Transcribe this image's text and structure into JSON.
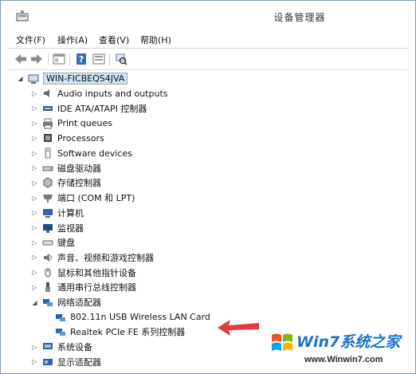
{
  "window": {
    "title": "设备管理器"
  },
  "menu": [
    "文件(F)",
    "操作(A)",
    "查看(V)",
    "帮助(H)"
  ],
  "tree": {
    "root": "WIN-FICBEQS4JVA",
    "categories": [
      {
        "label": "Audio inputs and outputs",
        "icon": "speaker-icon"
      },
      {
        "label": "IDE ATA/ATAPI 控制器",
        "icon": "ide-controller-icon"
      },
      {
        "label": "Print queues",
        "icon": "printer-icon"
      },
      {
        "label": "Processors",
        "icon": "processor-icon"
      },
      {
        "label": "Software devices",
        "icon": "software-device-icon"
      },
      {
        "label": "磁盘驱动器",
        "icon": "disk-drive-icon"
      },
      {
        "label": "存储控制器",
        "icon": "storage-controller-icon"
      },
      {
        "label": "端口 (COM 和 LPT)",
        "icon": "port-icon"
      },
      {
        "label": "计算机",
        "icon": "computer-icon"
      },
      {
        "label": "监视器",
        "icon": "monitor-icon"
      },
      {
        "label": "键盘",
        "icon": "keyboard-icon"
      },
      {
        "label": "声音、视频和游戏控制器",
        "icon": "sound-video-icon"
      },
      {
        "label": "鼠标和其他指针设备",
        "icon": "mouse-icon"
      },
      {
        "label": "通用串行总线控制器",
        "icon": "usb-icon"
      },
      {
        "label": "网络适配器",
        "icon": "network-adapter-icon",
        "expanded": true
      },
      {
        "label": "系统设备",
        "icon": "system-device-icon"
      },
      {
        "label": "显示适配器",
        "icon": "display-adapter-icon"
      }
    ],
    "network_children": [
      "802.11n USB Wireless LAN Card",
      "Realtek PCIe FE 系列控制器"
    ]
  },
  "watermark": {
    "brand": "Win7系统之家",
    "url": "www.Winwin7.com"
  },
  "colors": {
    "selection": "#cde6f7",
    "arrow": "#e23b3b",
    "watermark_blue": "#1d76c9"
  }
}
